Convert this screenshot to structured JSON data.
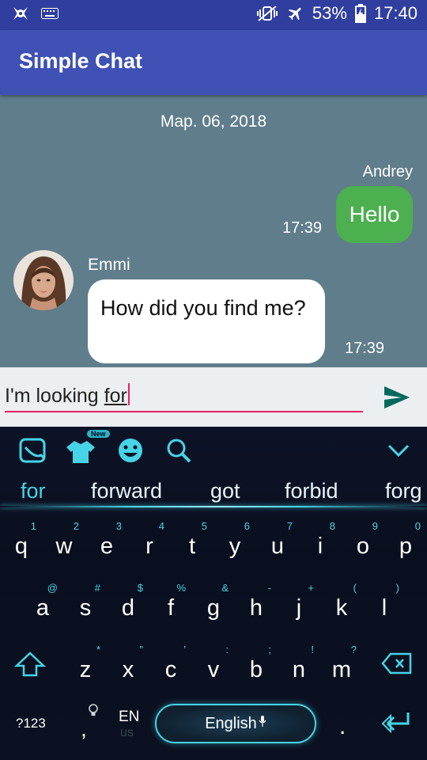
{
  "status_bar": {
    "battery": "53%",
    "time": "17:40"
  },
  "app_bar": {
    "title": "Simple Chat"
  },
  "chat": {
    "date": "Map. 06, 2018",
    "messages": [
      {
        "sender": "Andrey",
        "text": "Hello",
        "time": "17:39",
        "side": "right",
        "color": "#4caf50"
      },
      {
        "sender": "Emmi",
        "text": "How did you find me?",
        "time": "17:39",
        "side": "left",
        "color": "#ffffff"
      }
    ]
  },
  "input": {
    "value_prefix": "I'm looking ",
    "value_composing": "for"
  },
  "keyboard": {
    "toolbar_badge": "New",
    "suggestions": [
      "for",
      "forward",
      "got",
      "forbid",
      "forg"
    ],
    "row1": [
      {
        "k": "q",
        "s": "1"
      },
      {
        "k": "w",
        "s": "2"
      },
      {
        "k": "e",
        "s": "3"
      },
      {
        "k": "r",
        "s": "4"
      },
      {
        "k": "t",
        "s": "5"
      },
      {
        "k": "y",
        "s": "6"
      },
      {
        "k": "u",
        "s": "7"
      },
      {
        "k": "i",
        "s": "8"
      },
      {
        "k": "o",
        "s": "9"
      },
      {
        "k": "p",
        "s": "0"
      }
    ],
    "row2": [
      {
        "k": "a",
        "s": "@"
      },
      {
        "k": "s",
        "s": "#"
      },
      {
        "k": "d",
        "s": "$"
      },
      {
        "k": "f",
        "s": "%"
      },
      {
        "k": "g",
        "s": "&"
      },
      {
        "k": "h",
        "s": "-"
      },
      {
        "k": "j",
        "s": "+"
      },
      {
        "k": "k",
        "s": "("
      },
      {
        "k": "l",
        "s": ")"
      }
    ],
    "row3": [
      {
        "k": "z",
        "s": "*"
      },
      {
        "k": "x",
        "s": "\""
      },
      {
        "k": "c",
        "s": "'"
      },
      {
        "k": "v",
        "s": ":"
      },
      {
        "k": "b",
        "s": ";"
      },
      {
        "k": "n",
        "s": "!"
      },
      {
        "k": "m",
        "s": "?"
      }
    ],
    "symbols_label": "?123",
    "comma": ",",
    "lang_short": "EN",
    "lang_sub": "us",
    "space_label": "English",
    "period": ".",
    "accent_color": "#46d4e6"
  }
}
